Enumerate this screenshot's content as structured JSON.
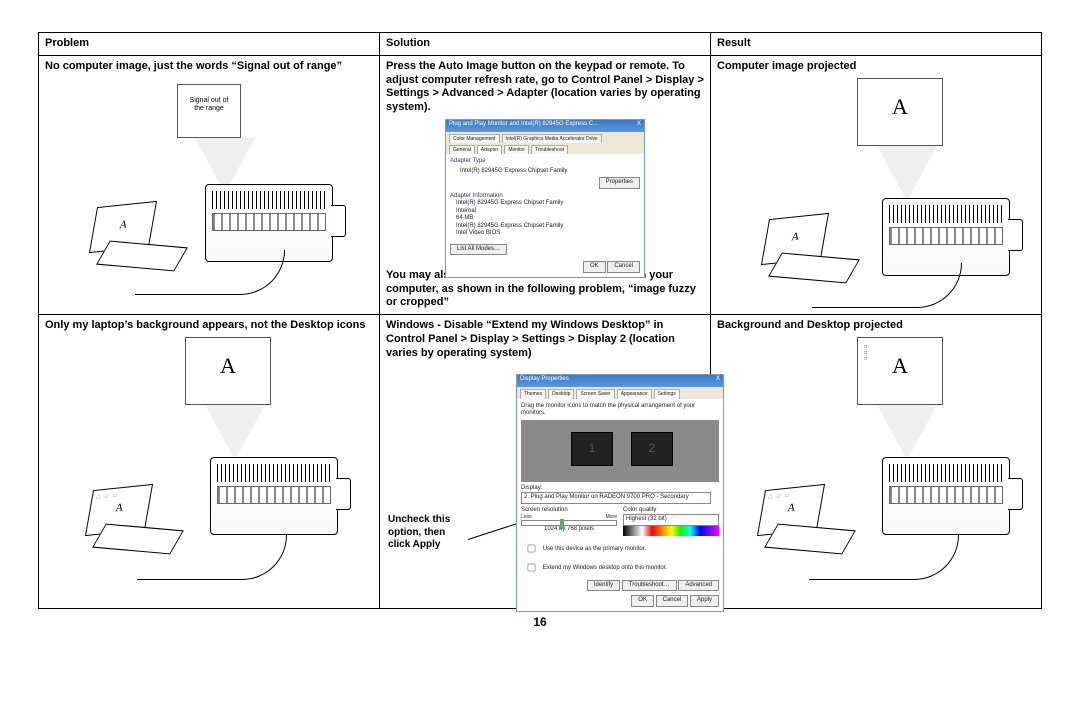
{
  "page_number": "16",
  "headers": {
    "problem": "Problem",
    "solution": "Solution",
    "result": "Result"
  },
  "row1": {
    "problem_title": "No computer image, just the words “Signal out of range”",
    "screen_text": "Signal out of\nthe range",
    "solution_top": "Press the Auto Image button on the keypad or remote. To adjust computer refresh rate, go to Control Panel > Display > Settings > Advanced > Adapter (location varies by operating system).",
    "solution_bottom": "You may also need to set a different resolution on your computer, as shown in the following problem, “image fuzzy or cropped”",
    "result_title": "Computer image projected",
    "dialog": {
      "title": "Plug and Play Monitor and Intel(R) 82945G Express C…",
      "tabs": [
        "Color Management",
        "Intel(R) Graphics Media Accelerator Drive",
        "General",
        "Adapter",
        "Monitor",
        "Troubleshoot"
      ],
      "l_adapter_type": "Adapter Type",
      "v_adapter_type": "Intel(R) 82945G Express Chipset Family",
      "btn_props": "Properties",
      "l_info": "Adapter Information",
      "rows": {
        "Chip Type": "Intel(R) 82945G Express Chipset Family",
        "DAC Type": "Internal",
        "Memory Size": "64 MB",
        "Adapter String": "Intel(R) 82945G Express Chipset Family",
        "Bios Information": "Intel Video BIOS"
      },
      "btn_modes": "List All Modes…",
      "btn_ok": "OK",
      "btn_cancel": "Cancel"
    }
  },
  "row2": {
    "problem_title": "Only my laptop’s background appears, not the Desktop icons",
    "solution_top": "Windows - Disable “Extend my Windows Desktop” in Control Panel > Display > Settings > Display 2 (location varies by operating system)",
    "callout": "Uncheck this option, then click Apply",
    "result_title": "Background and Desktop projected",
    "dialog": {
      "title": "Display Properties",
      "tabs": [
        "Themes",
        "Desktop",
        "Screen Saver",
        "Appearance",
        "Settings"
      ],
      "instr": "Drag the monitor icons to match the physical arrangement of your monitors.",
      "l_display": "Display:",
      "v_display": "2. Plug and Play Monitor on RADEON 9700 PRO - Secondary",
      "l_res": "Screen resolution",
      "v_res": "1024 by 768 pixels",
      "res_less": "Less",
      "res_more": "More",
      "l_cq": "Color quality",
      "v_cq": "Highest (32 bit)",
      "chk1": "Use this device as the primary monitor.",
      "chk2": "Extend my Windows desktop onto this monitor.",
      "btn_identify": "Identify",
      "btn_trouble": "Troubleshoot…",
      "btn_adv": "Advanced",
      "btn_ok": "OK",
      "btn_cancel": "Cancel",
      "btn_apply": "Apply"
    }
  },
  "letter_A": "A"
}
